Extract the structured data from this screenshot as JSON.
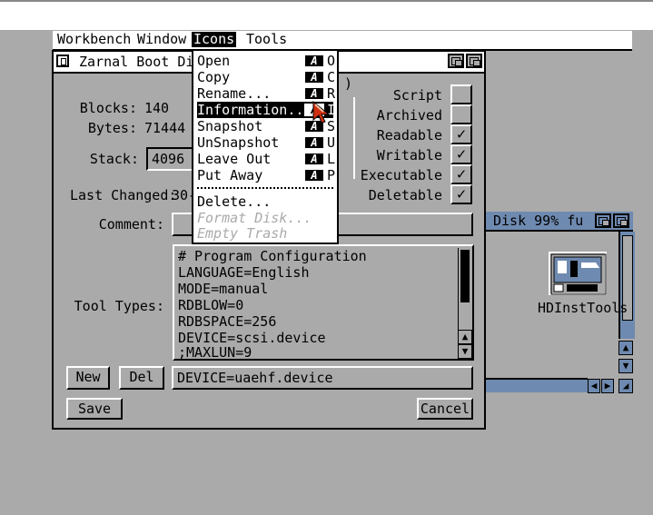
{
  "menubar": {
    "items": [
      "Workbench",
      "Window",
      "Icons",
      "Tools"
    ],
    "active": "Icons"
  },
  "info_window": {
    "title": "Zarnal Boot Disk",
    "blocks_label": "Blocks:",
    "blocks_value": "140",
    "bytes_label": "Bytes:",
    "bytes_value": "71444",
    "stack_label": "Stack:",
    "stack_value": "4096",
    "last_changed_label": "Last Changed:",
    "last_changed_value": "30-",
    "comment_label": "Comment:",
    "comment_value": "",
    "tooltypes_label": "Tool Types:",
    "tooltypes": [
      "# Program Configuration",
      "LANGUAGE=English",
      "MODE=manual",
      "RDBLOW=0",
      "RDBSPACE=256",
      "DEVICE=scsi.device",
      ";MAXLUN=9"
    ],
    "tooltype_edit_value": "DEVICE=uaehf.device",
    "hidden_paren": ")",
    "flags": [
      {
        "label": "Script",
        "checked": false
      },
      {
        "label": "Archived",
        "checked": false
      },
      {
        "label": "Readable",
        "checked": true
      },
      {
        "label": "Writable",
        "checked": true
      },
      {
        "label": "Executable",
        "checked": true
      },
      {
        "label": "Deletable",
        "checked": true
      }
    ],
    "check_glyph": "✓",
    "new_button": "New",
    "del_button": "Del",
    "save_button": "Save",
    "cancel_button": "Cancel"
  },
  "icons_menu": {
    "items": [
      {
        "label": "Open",
        "key": "O",
        "enabled": true
      },
      {
        "label": "Copy",
        "key": "C",
        "enabled": true
      },
      {
        "label": "Rename...",
        "key": "R",
        "enabled": true
      },
      {
        "label": "Information...",
        "key": "I",
        "enabled": true,
        "highlighted": true
      },
      {
        "label": "Snapshot",
        "key": "S",
        "enabled": true
      },
      {
        "label": "UnSnapshot",
        "key": "U",
        "enabled": true
      },
      {
        "label": "Leave Out",
        "key": "L",
        "enabled": true
      },
      {
        "label": "Put Away",
        "key": "P",
        "enabled": true
      },
      {
        "label": "Delete...",
        "key": "",
        "enabled": true
      },
      {
        "label": "Format Disk...",
        "key": "",
        "enabled": false
      },
      {
        "label": "Empty Trash",
        "key": "",
        "enabled": false
      }
    ],
    "amiga_key_glyph": "A"
  },
  "background_window": {
    "title": "Disk  99% fu",
    "icon_label": "HDInstTools"
  },
  "colors": {
    "desktop": "#aaaaaa",
    "window_blue": "#6f8ab0",
    "white": "#ffffff",
    "black": "#000000",
    "pointer": "#d03010"
  }
}
